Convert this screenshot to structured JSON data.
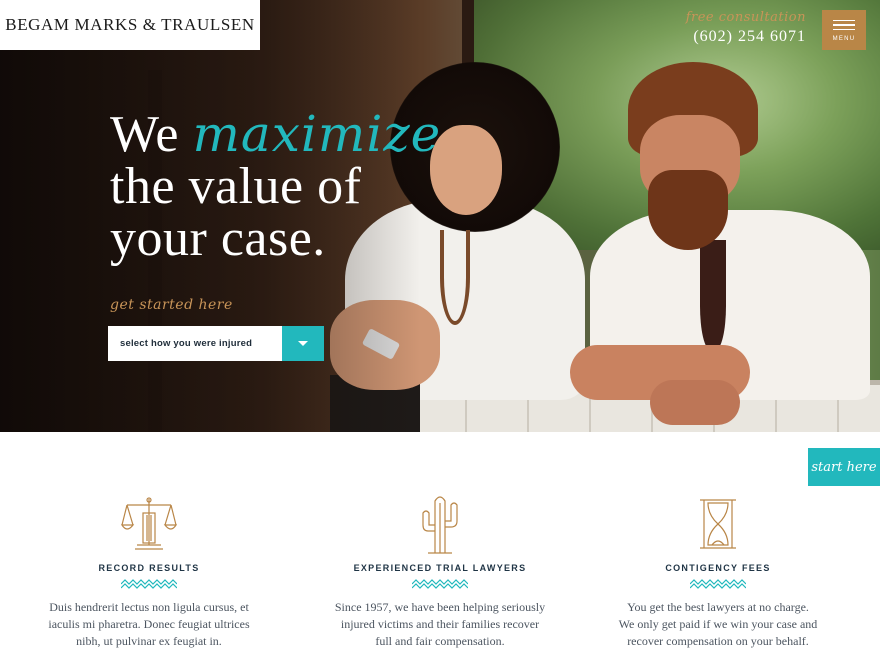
{
  "brand": {
    "logo": "BEGAM MARKS & TRAULSEN"
  },
  "header": {
    "consult_label": "free consultation",
    "phone": "(602) 254 6071",
    "menu_label": "MENU"
  },
  "hero": {
    "headline_part1": "We",
    "headline_accent": "maximize",
    "headline_line2": "the value of",
    "headline_line3": "your case.",
    "get_started": "get started here",
    "select_value": "select how you were injured"
  },
  "sticky": {
    "start_here": "start here"
  },
  "features": [
    {
      "icon": "scales-of-justice-icon",
      "title": "RECORD RESULTS",
      "desc": [
        "Duis hendrerit lectus non ligula cursus, et",
        "iaculis mi pharetra. Donec feugiat ultrices",
        "nibh, ut pulvinar ex feugiat in."
      ]
    },
    {
      "icon": "cactus-icon",
      "title": "EXPERIENCED TRIAL LAWYERS",
      "desc": [
        "Since 1957, we have been helping seriously",
        "injured victims and their families recover",
        "full and fair compensation."
      ]
    },
    {
      "icon": "hourglass-icon",
      "title": "CONTIGENCY FEES",
      "desc": [
        "You get the best lawyers at no charge.",
        "We only get paid if we win your case and",
        "recover compensation on your behalf."
      ]
    }
  ],
  "colors": {
    "accent_teal": "#22b8bd",
    "gold": "#b98647",
    "navy": "#1f3445"
  }
}
